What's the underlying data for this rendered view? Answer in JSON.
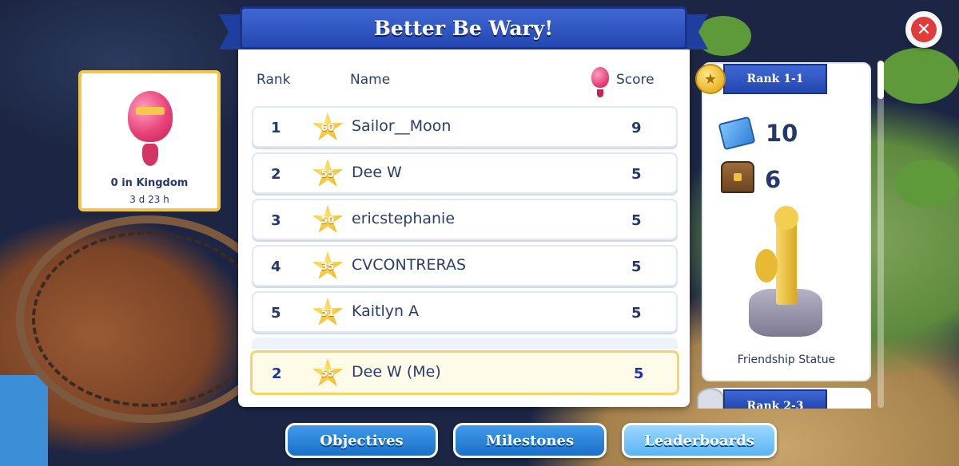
{
  "banner": {
    "title": "Better Be Wary!"
  },
  "event": {
    "label": "0 in Kingdom",
    "time_left": "3 d 23 h"
  },
  "leaderboard": {
    "headers": {
      "rank": "Rank",
      "name": "Name",
      "score": "Score"
    },
    "rows": [
      {
        "rank": "1",
        "level": "60",
        "name": "Sailor__Moon",
        "score": "9"
      },
      {
        "rank": "2",
        "level": "55",
        "name": "Dee W",
        "score": "5"
      },
      {
        "rank": "3",
        "level": "50",
        "name": "ericstephanie",
        "score": "5"
      },
      {
        "rank": "4",
        "level": "35",
        "name": "CVCONTRERAS",
        "score": "5"
      },
      {
        "rank": "5",
        "level": "51",
        "name": "Kaitlyn A",
        "score": "5"
      }
    ],
    "me": {
      "rank": "2",
      "level": "55",
      "name": "Dee W (Me)",
      "score": "5"
    }
  },
  "rewards": {
    "tab_label": "Rank 1-1",
    "blueprints": "10",
    "chests": "6",
    "item_name": "Friendship Statue",
    "next_tab_label": "Rank 2-3"
  },
  "tabs": [
    {
      "label": "Objectives",
      "active": false
    },
    {
      "label": "Milestones",
      "active": false
    },
    {
      "label": "Leaderboards",
      "active": true
    }
  ],
  "icons": {
    "close": "close-icon",
    "trophy": "trophy-icon",
    "balloon": "hot-air-balloon-icon",
    "blueprint": "blueprint-icon",
    "chest": "treasure-chest-icon",
    "star": "level-star-icon"
  },
  "colors": {
    "banner_blue": "#2447b0",
    "tab_blue": "#1b6fc9",
    "close_red": "#e23b3b",
    "highlight_gold": "#f6d46a",
    "text_navy": "#25386b"
  }
}
